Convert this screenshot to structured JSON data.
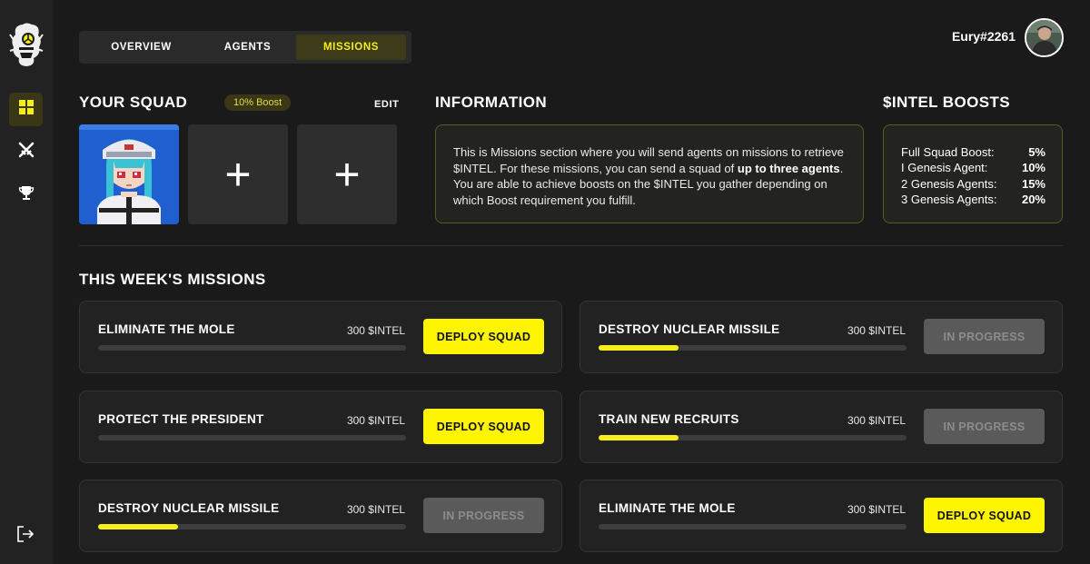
{
  "tabs": [
    {
      "label": "OVERVIEW",
      "active": false
    },
    {
      "label": "AGENTS",
      "active": false
    },
    {
      "label": "MISSIONS",
      "active": true
    }
  ],
  "user": {
    "name": "Eury#2261"
  },
  "squad": {
    "title": "YOUR SQUAD",
    "boost_badge": "10% Boost",
    "edit_label": "EDIT",
    "slots": [
      {
        "type": "agent"
      },
      {
        "type": "empty",
        "glyph": "+"
      },
      {
        "type": "empty",
        "glyph": "+"
      }
    ]
  },
  "information": {
    "title": "INFORMATION",
    "text_1": "This is Missions section where you will send agents on missions to retrieve $INTEL. For these missions, you can send a squad of ",
    "text_bold": "up to three agents",
    "text_2": ". You are able to achieve boosts on the $INTEL you gather depending on which Boost requirement you fulfill."
  },
  "boosts": {
    "title": "$INTEL BOOSTS",
    "rows": [
      {
        "label": "Full Squad Boost:",
        "value": "5%"
      },
      {
        "label": "I Genesis Agent:",
        "value": "10%"
      },
      {
        "label": "2 Genesis Agents:",
        "value": "15%"
      },
      {
        "label": "3 Genesis Agents:",
        "value": "20%"
      }
    ]
  },
  "missions": {
    "title": "THIS WEEK'S MISSIONS",
    "items": [
      {
        "title": "ELIMINATE THE MOLE",
        "reward": "300 $INTEL",
        "progress": 0,
        "action": "DEPLOY SQUAD",
        "state": "deploy"
      },
      {
        "title": "DESTROY NUCLEAR MISSILE",
        "reward": "300 $INTEL",
        "progress": 0.26,
        "action": "IN PROGRESS",
        "state": "progress"
      },
      {
        "title": "PROTECT THE PRESIDENT",
        "reward": "300 $INTEL",
        "progress": 0,
        "action": "DEPLOY SQUAD",
        "state": "deploy"
      },
      {
        "title": "TRAIN NEW RECRUITS",
        "reward": "300 $INTEL",
        "progress": 0.26,
        "action": "IN PROGRESS",
        "state": "progress"
      },
      {
        "title": "DESTROY NUCLEAR MISSILE",
        "reward": "300 $INTEL",
        "progress": 0.26,
        "action": "IN PROGRESS",
        "state": "progress"
      },
      {
        "title": "ELIMINATE THE MOLE",
        "reward": "300 $INTEL",
        "progress": 0,
        "action": "DEPLOY SQUAD",
        "state": "deploy"
      }
    ]
  },
  "colors": {
    "accent": "#fff500",
    "background": "#1a1a1a",
    "card": "#222222"
  },
  "icons": {
    "nav": [
      "dashboard-icon",
      "swords-icon",
      "trophy-icon"
    ],
    "logout": "logout-icon"
  }
}
